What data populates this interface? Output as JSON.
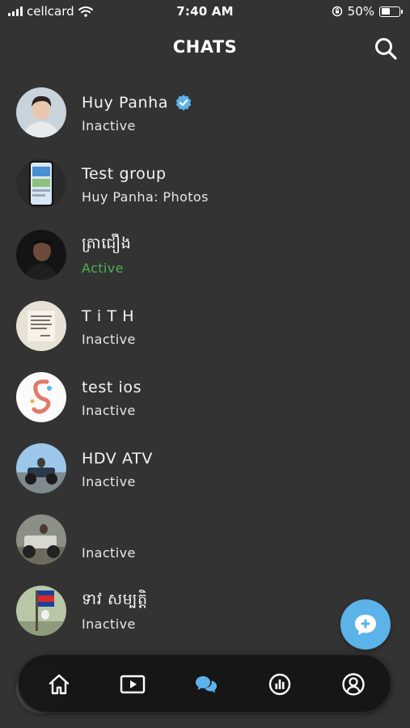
{
  "status_bar": {
    "carrier": "cellcard",
    "time": "7:40 AM",
    "battery_percent": "50%",
    "battery_level": 0.5,
    "icons": [
      "signal-bars-icon",
      "wifi-icon",
      "orientation-lock-icon",
      "battery-icon"
    ]
  },
  "header": {
    "title": "CHATS",
    "search_icon": "search-icon"
  },
  "chats": [
    {
      "name": "Huy Panha",
      "verified": true,
      "status": "Inactive",
      "active": false
    },
    {
      "name": "Test group",
      "verified": false,
      "status": "Huy Panha: Photos",
      "active": false
    },
    {
      "name": "ត្រាជឿង",
      "verified": false,
      "status": "Active",
      "active": true
    },
    {
      "name": "T i T H",
      "verified": false,
      "status": "Inactive",
      "active": false
    },
    {
      "name": "test ios",
      "verified": false,
      "status": "Inactive",
      "active": false
    },
    {
      "name": "HDV ATV",
      "verified": false,
      "status": "Inactive",
      "active": false
    },
    {
      "name": "",
      "verified": false,
      "status": "Inactive",
      "active": false
    },
    {
      "name": "ទាវ សម្បត្តិ",
      "verified": false,
      "status": "Inactive",
      "active": false
    }
  ],
  "fab": {
    "icon": "new-chat-icon"
  },
  "bottom_nav": {
    "items": [
      {
        "id": "home",
        "icon": "home-icon",
        "selected": false
      },
      {
        "id": "videos",
        "icon": "play-icon",
        "selected": false
      },
      {
        "id": "chats",
        "icon": "chat-bubbles-icon",
        "selected": true
      },
      {
        "id": "stats",
        "icon": "stats-icon",
        "selected": false
      },
      {
        "id": "profile",
        "icon": "profile-icon",
        "selected": false
      }
    ]
  },
  "colors": {
    "background": "#333333",
    "accent": "#5cb3ea",
    "active_status": "#4caf50",
    "nav_background": "#141414"
  }
}
